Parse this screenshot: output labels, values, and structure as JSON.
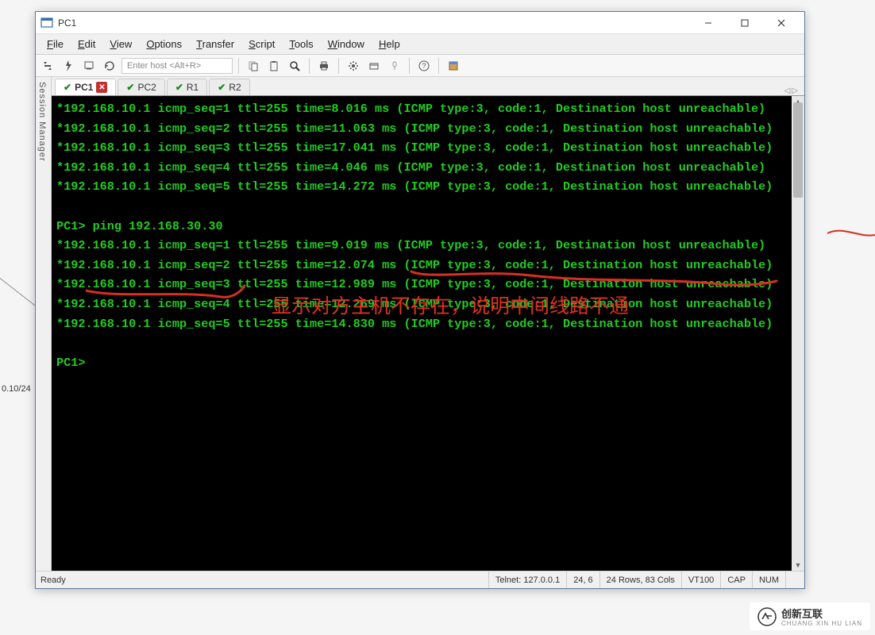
{
  "window": {
    "title": "PC1"
  },
  "menu": {
    "items": [
      "File",
      "Edit",
      "View",
      "Options",
      "Transfer",
      "Script",
      "Tools",
      "Window",
      "Help"
    ]
  },
  "toolbar": {
    "host_placeholder": "Enter host <Alt+R>"
  },
  "session_manager_label": "Session Manager",
  "tabs": [
    {
      "label": "PC1",
      "active": true,
      "closeable": true
    },
    {
      "label": "PC2",
      "active": false,
      "closeable": false
    },
    {
      "label": "R1",
      "active": false,
      "closeable": false
    },
    {
      "label": "R2",
      "active": false,
      "closeable": false
    }
  ],
  "terminal_lines": [
    "*192.168.10.1 icmp_seq=1 ttl=255 time=8.016 ms (ICMP type:3, code:1, Destination host unreachable)",
    "*192.168.10.1 icmp_seq=2 ttl=255 time=11.063 ms (ICMP type:3, code:1, Destination host unreachable)",
    "*192.168.10.1 icmp_seq=3 ttl=255 time=17.041 ms (ICMP type:3, code:1, Destination host unreachable)",
    "*192.168.10.1 icmp_seq=4 ttl=255 time=4.046 ms (ICMP type:3, code:1, Destination host unreachable)",
    "*192.168.10.1 icmp_seq=5 ttl=255 time=14.272 ms (ICMP type:3, code:1, Destination host unreachable)",
    "",
    "PC1> ping 192.168.30.30",
    "*192.168.10.1 icmp_seq=1 ttl=255 time=9.019 ms (ICMP type:3, code:1, Destination host unreachable)",
    "*192.168.10.1 icmp_seq=2 ttl=255 time=12.074 ms (ICMP type:3, code:1, Destination host unreachable)",
    "*192.168.10.1 icmp_seq=3 ttl=255 time=12.989 ms (ICMP type:3, code:1, Destination host unreachable)",
    "*192.168.10.1 icmp_seq=4 ttl=255 time=12.269 ms (ICMP type:3, code:1, Destination host unreachable)",
    "*192.168.10.1 icmp_seq=5 ttl=255 time=14.830 ms (ICMP type:3, code:1, Destination host unreachable)",
    "",
    "PC1>"
  ],
  "annotation": {
    "text": "显示对方主机不存在，说明中间线路不通"
  },
  "status": {
    "ready": "Ready",
    "protocol": "Telnet: 127.0.0.1",
    "cursor": "24,  6",
    "size": "24 Rows, 83 Cols",
    "emulation": "VT100",
    "caps": "CAP",
    "num": "NUM"
  },
  "background": {
    "ip_label": "0.10/24"
  },
  "watermark": {
    "main": "创新互联",
    "sub": "CHUANG XIN HU LIAN"
  }
}
